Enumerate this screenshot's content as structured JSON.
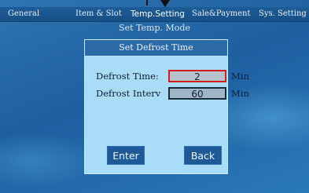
{
  "tabs": [
    {
      "label": "General"
    },
    {
      "label": "Item & Slot"
    },
    {
      "label": "Temp.Setting"
    },
    {
      "label": "Sale&Payment"
    },
    {
      "label": "Sys. Setting"
    }
  ],
  "active_tab": "Temp.Setting",
  "subtitle": "Set Temp. Mode",
  "dialog": {
    "title": "Set Defrost Time",
    "rows": [
      {
        "label": "Defrost Time:",
        "value": "2",
        "unit": "Min"
      },
      {
        "label": "Defrost Interv",
        "value": "60",
        "unit": "Min"
      }
    ],
    "enter_label": "Enter",
    "back_label": "Back"
  },
  "colors": {
    "background": "#1e5fa0",
    "tab_bar": "#1d5d98",
    "dialog_body": "#a9dcf7",
    "dialog_header": "#2d6aa8",
    "focused_field_border": "#d21d1d",
    "button": "#1f5a98"
  }
}
